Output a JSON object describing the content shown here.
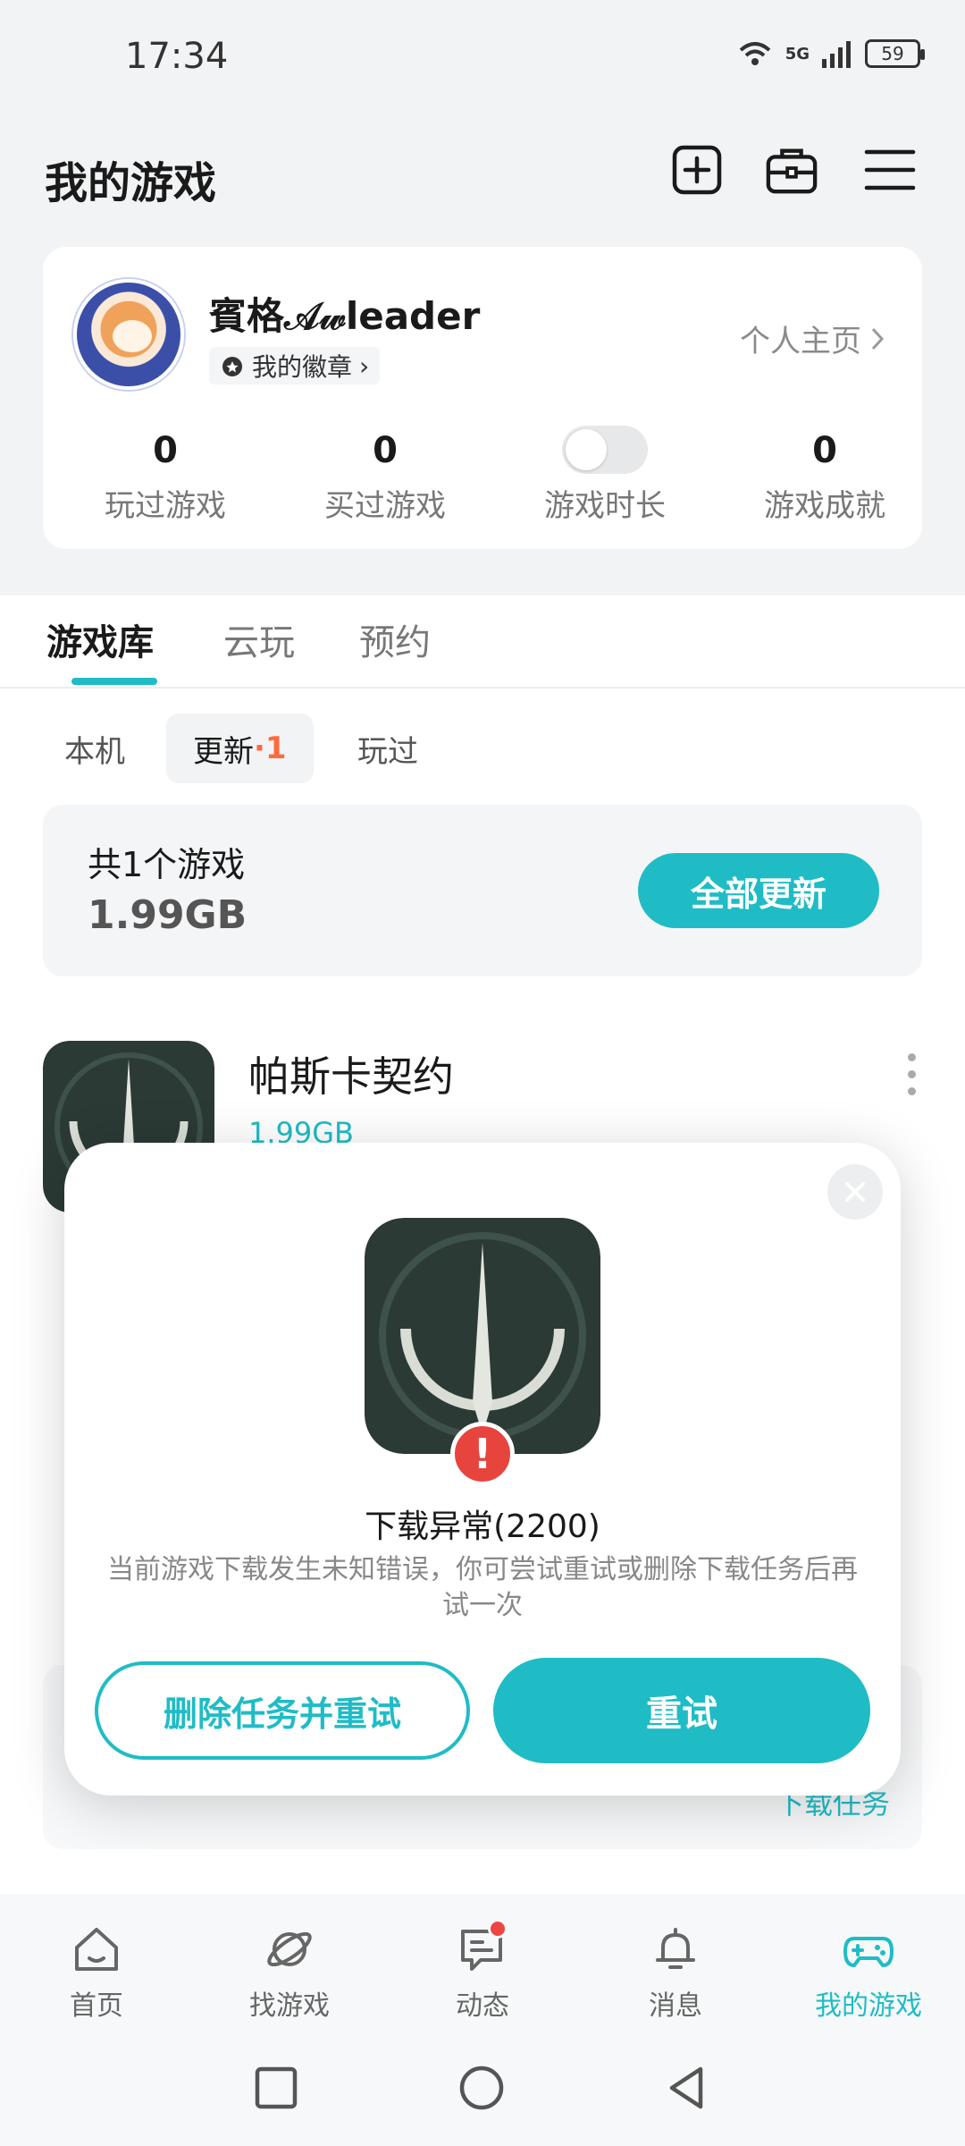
{
  "status_bar": {
    "time": "17:34",
    "network": "5G",
    "battery": "59"
  },
  "header": {
    "title": "我的游戏"
  },
  "profile": {
    "username": "賓格𝒜𝓌leader",
    "badge_label": "我的徽章",
    "homepage_label": "个人主页",
    "stats": [
      {
        "value": "0",
        "label": "玩过游戏"
      },
      {
        "value": "0",
        "label": "买过游戏"
      },
      {
        "value": "",
        "label": "游戏时长"
      },
      {
        "value": "0",
        "label": "游戏成就"
      }
    ]
  },
  "tabs": [
    "游戏库",
    "云玩",
    "预约"
  ],
  "subtabs": {
    "local": "本机",
    "update": "更新",
    "update_count": "1",
    "played": "玩过"
  },
  "update_panel": {
    "count_text": "共1个游戏",
    "size": "1.99GB",
    "update_all": "全部更新"
  },
  "game": {
    "name": "帕斯卡契约",
    "size": "1.99GB"
  },
  "background_card": {
    "text": "下载任务"
  },
  "modal": {
    "title": "下载异常(2200)",
    "description": "当前游戏下载发生未知错误，你可尝试重试或删除下载任务后再试一次",
    "delete_retry": "删除任务并重试",
    "retry": "重试",
    "error_mark": "!"
  },
  "bottom_nav": [
    {
      "label": "首页",
      "icon": "home-icon"
    },
    {
      "label": "找游戏",
      "icon": "planet-icon"
    },
    {
      "label": "动态",
      "icon": "chat-icon"
    },
    {
      "label": "消息",
      "icon": "bell-icon"
    },
    {
      "label": "我的游戏",
      "icon": "gamepad-icon"
    }
  ],
  "colors": {
    "accent": "#1fbcc6",
    "error": "#e8443e",
    "badge_orange": "#ff6a3d"
  }
}
